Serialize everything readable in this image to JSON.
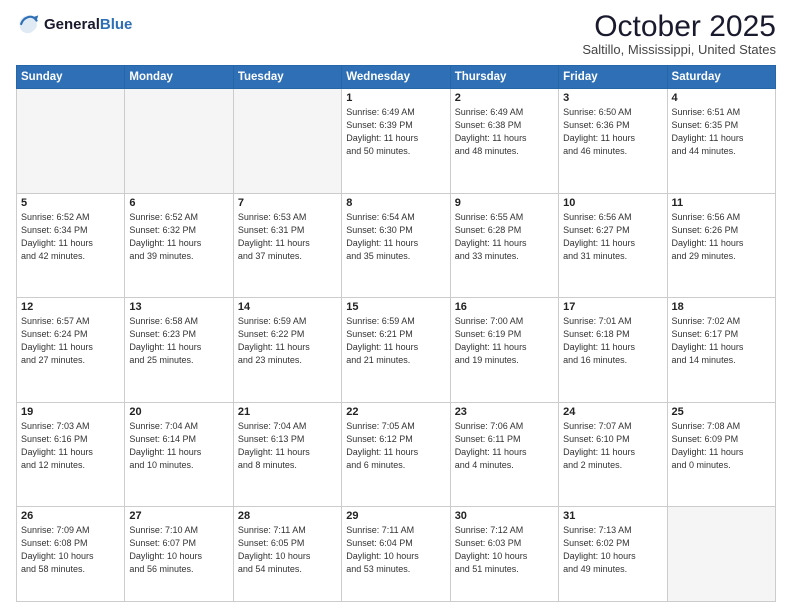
{
  "header": {
    "logo_line1": "General",
    "logo_line2": "Blue",
    "month": "October 2025",
    "location": "Saltillo, Mississippi, United States"
  },
  "weekdays": [
    "Sunday",
    "Monday",
    "Tuesday",
    "Wednesday",
    "Thursday",
    "Friday",
    "Saturday"
  ],
  "weeks": [
    [
      {
        "num": "",
        "info": ""
      },
      {
        "num": "",
        "info": ""
      },
      {
        "num": "",
        "info": ""
      },
      {
        "num": "1",
        "info": "Sunrise: 6:49 AM\nSunset: 6:39 PM\nDaylight: 11 hours\nand 50 minutes."
      },
      {
        "num": "2",
        "info": "Sunrise: 6:49 AM\nSunset: 6:38 PM\nDaylight: 11 hours\nand 48 minutes."
      },
      {
        "num": "3",
        "info": "Sunrise: 6:50 AM\nSunset: 6:36 PM\nDaylight: 11 hours\nand 46 minutes."
      },
      {
        "num": "4",
        "info": "Sunrise: 6:51 AM\nSunset: 6:35 PM\nDaylight: 11 hours\nand 44 minutes."
      }
    ],
    [
      {
        "num": "5",
        "info": "Sunrise: 6:52 AM\nSunset: 6:34 PM\nDaylight: 11 hours\nand 42 minutes."
      },
      {
        "num": "6",
        "info": "Sunrise: 6:52 AM\nSunset: 6:32 PM\nDaylight: 11 hours\nand 39 minutes."
      },
      {
        "num": "7",
        "info": "Sunrise: 6:53 AM\nSunset: 6:31 PM\nDaylight: 11 hours\nand 37 minutes."
      },
      {
        "num": "8",
        "info": "Sunrise: 6:54 AM\nSunset: 6:30 PM\nDaylight: 11 hours\nand 35 minutes."
      },
      {
        "num": "9",
        "info": "Sunrise: 6:55 AM\nSunset: 6:28 PM\nDaylight: 11 hours\nand 33 minutes."
      },
      {
        "num": "10",
        "info": "Sunrise: 6:56 AM\nSunset: 6:27 PM\nDaylight: 11 hours\nand 31 minutes."
      },
      {
        "num": "11",
        "info": "Sunrise: 6:56 AM\nSunset: 6:26 PM\nDaylight: 11 hours\nand 29 minutes."
      }
    ],
    [
      {
        "num": "12",
        "info": "Sunrise: 6:57 AM\nSunset: 6:24 PM\nDaylight: 11 hours\nand 27 minutes."
      },
      {
        "num": "13",
        "info": "Sunrise: 6:58 AM\nSunset: 6:23 PM\nDaylight: 11 hours\nand 25 minutes."
      },
      {
        "num": "14",
        "info": "Sunrise: 6:59 AM\nSunset: 6:22 PM\nDaylight: 11 hours\nand 23 minutes."
      },
      {
        "num": "15",
        "info": "Sunrise: 6:59 AM\nSunset: 6:21 PM\nDaylight: 11 hours\nand 21 minutes."
      },
      {
        "num": "16",
        "info": "Sunrise: 7:00 AM\nSunset: 6:19 PM\nDaylight: 11 hours\nand 19 minutes."
      },
      {
        "num": "17",
        "info": "Sunrise: 7:01 AM\nSunset: 6:18 PM\nDaylight: 11 hours\nand 16 minutes."
      },
      {
        "num": "18",
        "info": "Sunrise: 7:02 AM\nSunset: 6:17 PM\nDaylight: 11 hours\nand 14 minutes."
      }
    ],
    [
      {
        "num": "19",
        "info": "Sunrise: 7:03 AM\nSunset: 6:16 PM\nDaylight: 11 hours\nand 12 minutes."
      },
      {
        "num": "20",
        "info": "Sunrise: 7:04 AM\nSunset: 6:14 PM\nDaylight: 11 hours\nand 10 minutes."
      },
      {
        "num": "21",
        "info": "Sunrise: 7:04 AM\nSunset: 6:13 PM\nDaylight: 11 hours\nand 8 minutes."
      },
      {
        "num": "22",
        "info": "Sunrise: 7:05 AM\nSunset: 6:12 PM\nDaylight: 11 hours\nand 6 minutes."
      },
      {
        "num": "23",
        "info": "Sunrise: 7:06 AM\nSunset: 6:11 PM\nDaylight: 11 hours\nand 4 minutes."
      },
      {
        "num": "24",
        "info": "Sunrise: 7:07 AM\nSunset: 6:10 PM\nDaylight: 11 hours\nand 2 minutes."
      },
      {
        "num": "25",
        "info": "Sunrise: 7:08 AM\nSunset: 6:09 PM\nDaylight: 11 hours\nand 0 minutes."
      }
    ],
    [
      {
        "num": "26",
        "info": "Sunrise: 7:09 AM\nSunset: 6:08 PM\nDaylight: 10 hours\nand 58 minutes."
      },
      {
        "num": "27",
        "info": "Sunrise: 7:10 AM\nSunset: 6:07 PM\nDaylight: 10 hours\nand 56 minutes."
      },
      {
        "num": "28",
        "info": "Sunrise: 7:11 AM\nSunset: 6:05 PM\nDaylight: 10 hours\nand 54 minutes."
      },
      {
        "num": "29",
        "info": "Sunrise: 7:11 AM\nSunset: 6:04 PM\nDaylight: 10 hours\nand 53 minutes."
      },
      {
        "num": "30",
        "info": "Sunrise: 7:12 AM\nSunset: 6:03 PM\nDaylight: 10 hours\nand 51 minutes."
      },
      {
        "num": "31",
        "info": "Sunrise: 7:13 AM\nSunset: 6:02 PM\nDaylight: 10 hours\nand 49 minutes."
      },
      {
        "num": "",
        "info": ""
      }
    ]
  ]
}
